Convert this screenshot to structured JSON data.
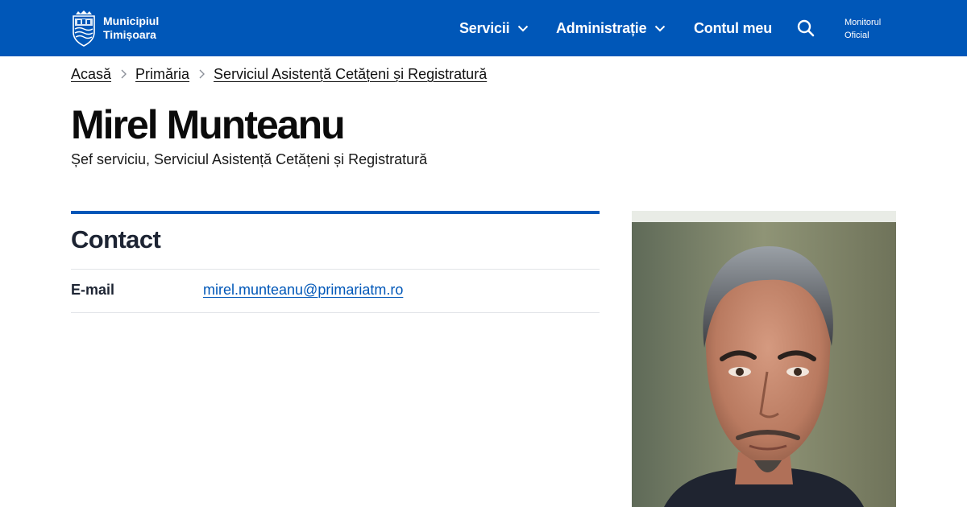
{
  "header": {
    "brand": {
      "line1": "Municipiul",
      "line2": "Timișoara",
      "icon": "city-crest-icon"
    },
    "nav": [
      {
        "label": "Servicii",
        "has_dropdown": true
      },
      {
        "label": "Administrație",
        "has_dropdown": true
      },
      {
        "label": "Contul meu",
        "has_dropdown": false
      }
    ],
    "search_icon": "search-icon",
    "monitor": {
      "line1": "Monitorul",
      "line2": "Oficial"
    },
    "colors": {
      "bar": "#0057b8",
      "text": "#ffffff"
    }
  },
  "breadcrumb": [
    {
      "label": "Acasă"
    },
    {
      "label": "Primăria"
    },
    {
      "label": "Serviciul Asistență Cetățeni și Registratură"
    }
  ],
  "person": {
    "name": "Mirel Munteanu",
    "role": "Șef serviciu, Serviciul Asistență Cetățeni și Registratură"
  },
  "contact": {
    "title": "Contact",
    "rows": [
      {
        "label": "E-mail",
        "value": "mirel.munteanu@primariatm.ro"
      }
    ],
    "accent": "#0057b8"
  },
  "photo": {
    "kind": "portrait-photo"
  }
}
